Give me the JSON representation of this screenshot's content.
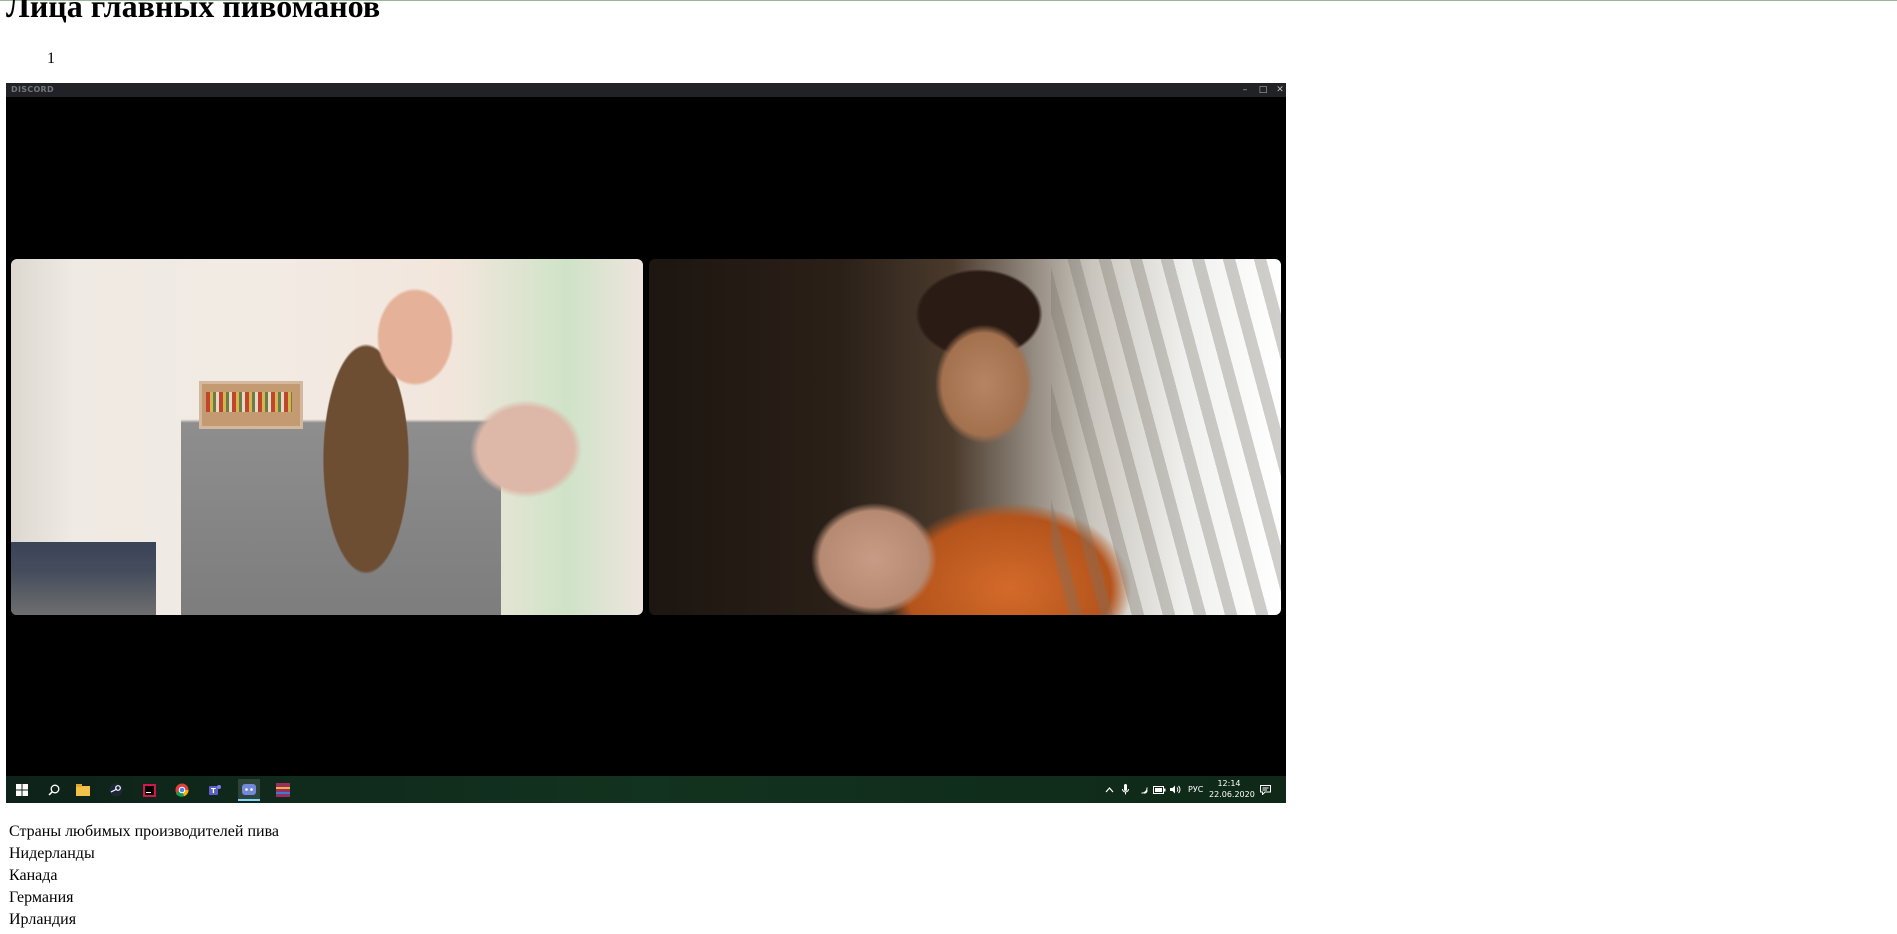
{
  "page": {
    "title": "Лица главных пивоманов",
    "list_number": "1"
  },
  "discord_window": {
    "brand": "DISCORD",
    "controls": {
      "minimize": "–",
      "maximize": "□",
      "close": "✕"
    },
    "taskbar": {
      "icons": [
        "windows-start-icon",
        "search-icon",
        "file-explorer-icon",
        "steam-icon",
        "jetbrains-icon",
        "chrome-icon",
        "teams-icon",
        "discord-icon",
        "winrar-icon"
      ],
      "active_icon": "discord-icon",
      "tray": {
        "language": "РУС",
        "time": "12:14",
        "date": "22.06.2020"
      }
    }
  },
  "countries": {
    "heading": "Страны любимых производителей пива",
    "items": [
      "Нидерланды",
      "Канада",
      "Германия",
      "Ирландия"
    ]
  }
}
